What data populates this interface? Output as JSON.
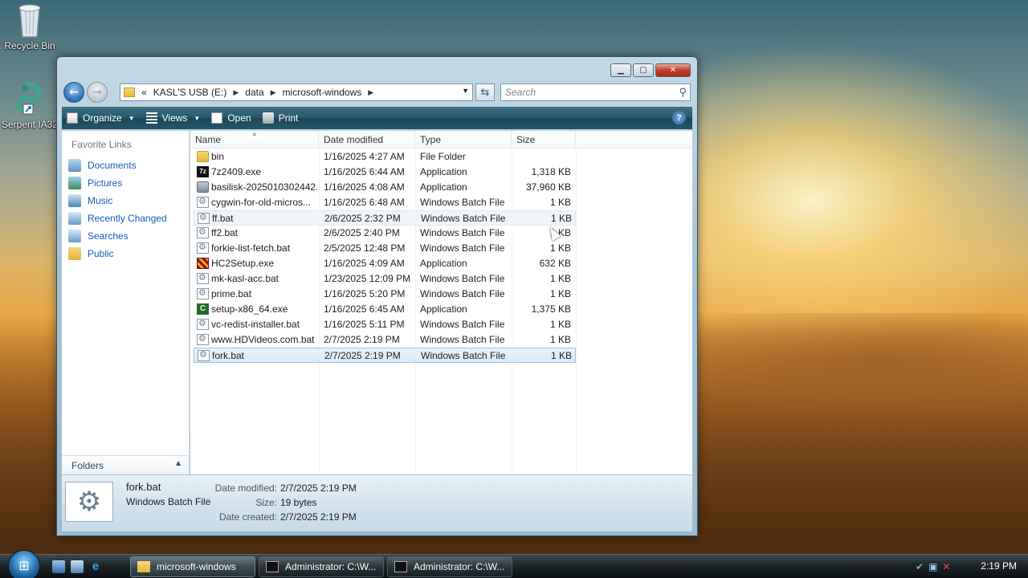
{
  "desktop": {
    "icons": [
      {
        "label": "Recycle Bin",
        "icon": "recycle-bin-icon"
      },
      {
        "label": "Serpent IA32",
        "icon": "serpent-icon"
      }
    ]
  },
  "window": {
    "controls": [
      "minimize",
      "maximize",
      "close"
    ],
    "address": {
      "overflow": "«",
      "crumbs": [
        "KASL'S USB (E:)",
        "data",
        "microsoft-windows"
      ]
    },
    "search_placeholder": "Search",
    "toolbar": {
      "organize": "Organize",
      "views": "Views",
      "open": "Open",
      "print": "Print"
    },
    "favorite_links": {
      "title": "Favorite Links",
      "items": [
        "Documents",
        "Pictures",
        "Music",
        "Recently Changed",
        "Searches",
        "Public"
      ]
    },
    "folders_label": "Folders",
    "columns": [
      "Name",
      "Date modified",
      "Type",
      "Size"
    ],
    "files": [
      {
        "name": "bin",
        "date": "1/16/2025 4:27 AM",
        "type": "File Folder",
        "size": "",
        "icon": "folder-icon"
      },
      {
        "name": "7z2409.exe",
        "date": "1/16/2025 6:44 AM",
        "type": "Application",
        "size": "1,318 KB",
        "icon": "7zip-icon"
      },
      {
        "name": "basilisk-2025010302442...",
        "date": "1/16/2025 4:08 AM",
        "type": "Application",
        "size": "37,960 KB",
        "icon": "application-icon"
      },
      {
        "name": "cygwin-for-old-micros...",
        "date": "1/16/2025 6:48 AM",
        "type": "Windows Batch File",
        "size": "1 KB",
        "icon": "batch-file-icon"
      },
      {
        "name": "ff.bat",
        "date": "2/6/2025 2:32 PM",
        "type": "Windows Batch File",
        "size": "1 KB",
        "icon": "batch-file-icon"
      },
      {
        "name": "ff2.bat",
        "date": "2/6/2025 2:40 PM",
        "type": "Windows Batch File",
        "size": "1 KB",
        "icon": "batch-file-icon"
      },
      {
        "name": "forkie-list-fetch.bat",
        "date": "2/5/2025 12:48 PM",
        "type": "Windows Batch File",
        "size": "1 KB",
        "icon": "batch-file-icon"
      },
      {
        "name": "HC2Setup.exe",
        "date": "1/16/2025 4:09 AM",
        "type": "Application",
        "size": "632 KB",
        "icon": "installer-icon"
      },
      {
        "name": "mk-kasl-acc.bat",
        "date": "1/23/2025 12:09 PM",
        "type": "Windows Batch File",
        "size": "1 KB",
        "icon": "batch-file-icon"
      },
      {
        "name": "prime.bat",
        "date": "1/16/2025 5:20 PM",
        "type": "Windows Batch File",
        "size": "1 KB",
        "icon": "batch-file-icon"
      },
      {
        "name": "setup-x86_64.exe",
        "date": "1/16/2025 6:45 AM",
        "type": "Application",
        "size": "1,375 KB",
        "icon": "cygwin-setup-icon"
      },
      {
        "name": "vc-redist-installer.bat",
        "date": "1/16/2025 5:11 PM",
        "type": "Windows Batch File",
        "size": "1 KB",
        "icon": "batch-file-icon"
      },
      {
        "name": "www.HDVideos.com.bat",
        "date": "2/7/2025 2:19 PM",
        "type": "Windows Batch File",
        "size": "1 KB",
        "icon": "batch-file-icon"
      },
      {
        "name": "fork.bat",
        "date": "2/7/2025 2:19 PM",
        "type": "Windows Batch File",
        "size": "1 KB",
        "icon": "batch-file-icon"
      }
    ],
    "details": {
      "name": "fork.bat",
      "type": "Windows Batch File",
      "date_modified_label": "Date modified:",
      "date_modified": "2/7/2025 2:19 PM",
      "size_label": "Size:",
      "size": "19 bytes",
      "date_created_label": "Date created:",
      "date_created": "2/7/2025 2:19 PM"
    }
  },
  "taskbar": {
    "buttons": [
      "microsoft-windows",
      "Administrator: C:\\W...",
      "Administrator: C:\\W..."
    ],
    "clock": "2:19 PM"
  }
}
